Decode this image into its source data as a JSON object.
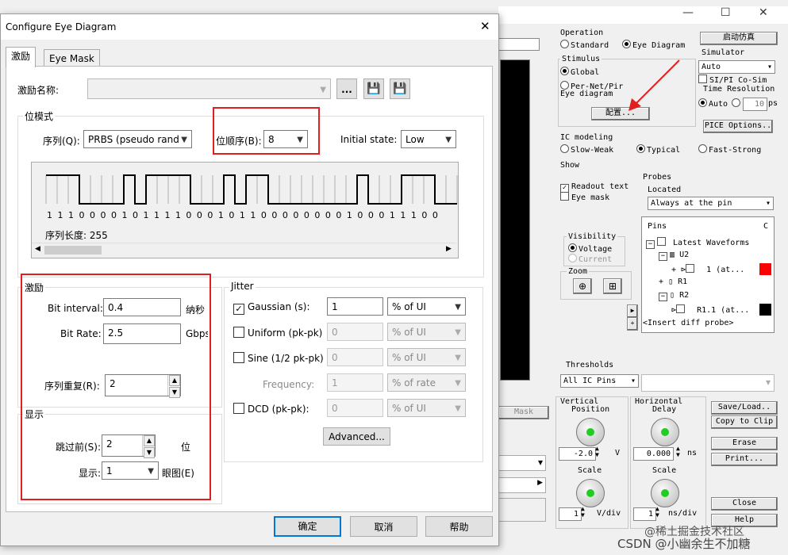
{
  "background_window": {
    "operation": {
      "title": "Operation",
      "standard": "Standard",
      "eye_diagram": "Eye Diagram",
      "start_button": "启动仿真"
    },
    "stimulus": {
      "title": "Stimulus",
      "global": "Global",
      "per_net": "Per-Net/Pir",
      "eye_diagram_label": "Eye diagram",
      "config_button": "配置..."
    },
    "simulator": {
      "title": "Simulator",
      "mode": "Auto",
      "si_pi": "SI/PI Co-Sim",
      "time_resolution": "Time Resolution",
      "auto": "Auto",
      "value": "10",
      "unit": "ps"
    },
    "pice_button": "PICE Options..",
    "ic_modeling": {
      "title": "IC modeling",
      "slow_weak": "Slow-Weak",
      "typical": "Typical",
      "fast_strong": "Fast-Strong"
    },
    "show": {
      "title": "Show",
      "readout_text": "Readout text",
      "eye_mask": "Eye mask"
    },
    "probes": {
      "title": "Probes",
      "located": "Located",
      "location": "Always at the pin",
      "pins": "Pins",
      "col_c": "C",
      "latest": "Latest Waveforms",
      "u2": "U2",
      "u2_1": "1 (at...",
      "r1": "R1",
      "r2": "R2",
      "r1_1": "R1.1 (at...",
      "insert": "<Insert diff probe>"
    },
    "visibility": {
      "title": "Visibility",
      "voltage": "Voltage",
      "current": "Current"
    },
    "zoom": {
      "title": "Zoom"
    },
    "thresholds": {
      "title": "Thresholds",
      "value": "All IC Pins"
    },
    "mask_button": "Mask",
    "vertical": {
      "title1": "Vertical",
      "title2": "Position",
      "value": "-2.0",
      "unit": "V",
      "scale": "Scale",
      "scale_value": "1",
      "scale_unit": "V/div"
    },
    "horizontal": {
      "title1": "Horizontal",
      "title2": "Delay",
      "value": "0.000",
      "unit": "ns",
      "scale": "Scale",
      "scale_value": "1",
      "scale_unit": "ns/div"
    },
    "buttons": {
      "save_load": "Save/Load..",
      "copy_clip": "Copy to Clip",
      "erase": "Erase",
      "print": "Print...",
      "close": "Close",
      "help": "Help"
    },
    "colors": {
      "probe1": "#ff0000",
      "probe2": "#000000"
    },
    "watermark": "CSDN @小幽余生不加糖",
    "watermark2": "@稀土掘金技术社区"
  },
  "dialog": {
    "title": "Configure Eye Diagram",
    "tabs": [
      {
        "label": "激励"
      },
      {
        "label": "Eye Mask"
      }
    ],
    "stim_name_label": "激励名称:",
    "browse_button": "...",
    "bit_mode": {
      "title": "位模式",
      "sequence_label": "序列(Q):",
      "sequence_value": "PRBS (pseudo rand",
      "bit_order_label": "位顺序(B):",
      "bit_order_value": "8",
      "initial_state_label": "Initial state:",
      "initial_state_value": "Low",
      "bits": "1 1 1 0 0 0 0 1 0 1 1 1 1 0 0 0 1 0 1 1 0 0 0 0 0 0 0 0 1 0 0 0 1 1 1 0 0",
      "seq_length": "序列长度: 255"
    },
    "stimulus": {
      "title": "激励",
      "bit_interval_label": "Bit interval:",
      "bit_interval_value": "0.4",
      "bit_interval_unit": "纳秒",
      "bit_rate_label": "Bit Rate:",
      "bit_rate_value": "2.5",
      "bit_rate_unit": "Gbps",
      "repeat_label": "序列重复(R):",
      "repeat_value": "2"
    },
    "display": {
      "title": "显示",
      "skip_label": "跳过前(S):",
      "skip_value": "2",
      "skip_unit": "位",
      "show_label": "显示:",
      "show_value": "1",
      "show_unit": "眼图(E)"
    },
    "jitter": {
      "title": "Jitter",
      "gaussian_label": "Gaussian (s):",
      "gaussian_value": "1",
      "gaussian_unit": "% of UI",
      "uniform_label": "Uniform (pk-pk)",
      "uniform_value": "0",
      "uniform_unit": "% of UI",
      "sine_label": "Sine (1/2 pk-pk)",
      "sine_value": "0",
      "sine_unit": "% of UI",
      "frequency_label": "Frequency:",
      "frequency_value": "1",
      "frequency_unit": "% of rate",
      "dcd_label": "DCD (pk-pk):",
      "dcd_value": "0",
      "dcd_unit": "% of UI",
      "advanced_button": "Advanced..."
    },
    "ok_button": "确定",
    "cancel_button": "取消",
    "help_button": "帮助"
  }
}
